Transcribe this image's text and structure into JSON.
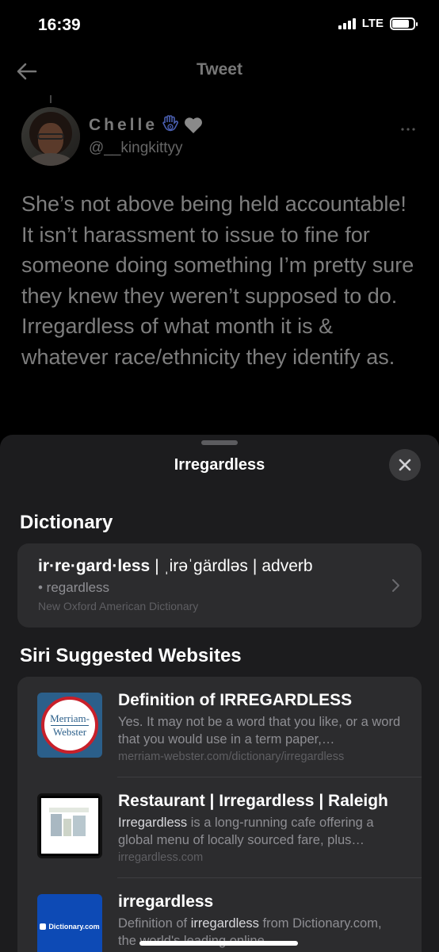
{
  "status_bar": {
    "time": "16:39",
    "network": "LTE"
  },
  "header": {
    "title": "Tweet"
  },
  "tweet": {
    "display_name": "Chelle",
    "handle": "@__kingkittyy",
    "text": "She’s not above being held accountable! It isn’t harassment to issue to fine for someone doing something I’m pretty sure they knew they weren’t supposed to do. Irregardless of what month it is & whatever race/ethnicity they identify as."
  },
  "lookup": {
    "title": "Irregardless",
    "dictionary": {
      "section_title": "Dictionary",
      "word": "ir·re·gard·less",
      "pronunciation": "ˌirəˈgärdləs",
      "part_of_speech": "adverb",
      "definition": "• regardless",
      "source": "New Oxford American Dictionary"
    },
    "websites": {
      "section_title": "Siri Suggested Websites",
      "items": [
        {
          "title": "Definition of IRREGARDLESS",
          "desc_pre": "",
          "desc_hl": "",
          "desc_post": "Yes. It may not be a word that you like, or a word that you would use in a term paper,…",
          "url": "merriam-webster.com/dictionary/irregardless",
          "thumb_line1": "Merriam-",
          "thumb_line2": "Webster"
        },
        {
          "title": "Restaurant | Irregardless | Raleigh",
          "desc_pre": "",
          "desc_hl": "Irregardless",
          "desc_post": " is a long-running cafe offering a global menu of locally sourced fare, plus…",
          "url": "irregardless.com"
        },
        {
          "title": "irregardless",
          "desc_pre": "Definition of ",
          "desc_hl": "irregardless",
          "desc_post": " from Dictionary.com, the world's leading online…",
          "url": "",
          "thumb_logo": "Dictionary.com"
        }
      ]
    }
  },
  "colors": {
    "background": "#000000",
    "sheet": "#1c1c1e",
    "card": "#2c2c2e",
    "secondary_text": "#8e8e93"
  }
}
